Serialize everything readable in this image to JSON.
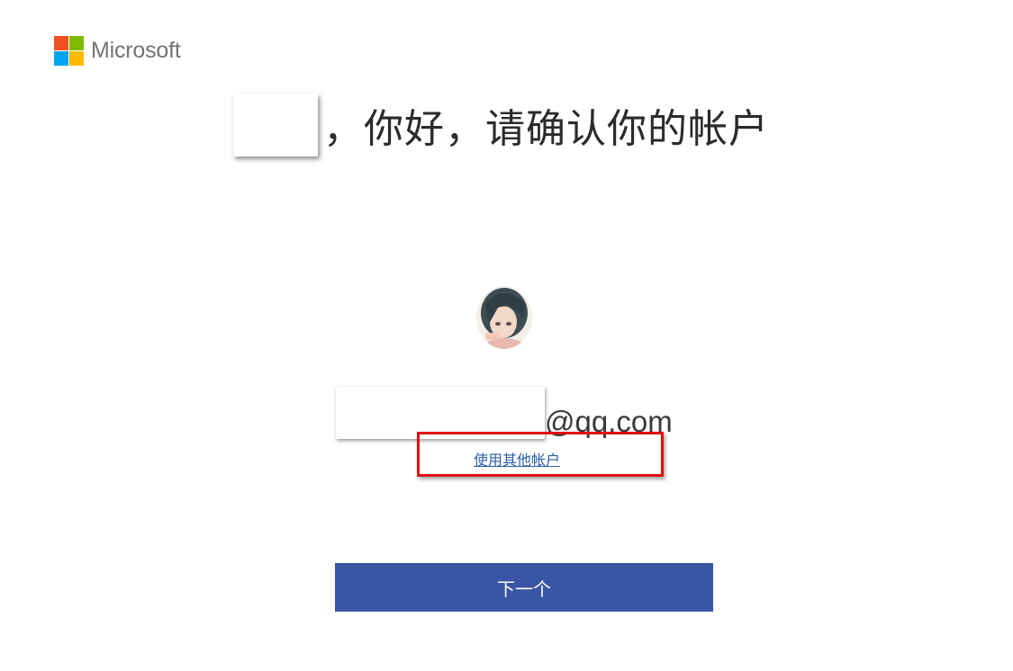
{
  "brand": {
    "name": "Microsoft",
    "logo_colors": [
      "#f25022",
      "#7fba00",
      "#00a4ef",
      "#ffb900"
    ]
  },
  "heading": {
    "greeting": "，你好，请确认你的帐户"
  },
  "account": {
    "avatar_icon": "user-avatar-icon",
    "email_domain": "@qq.com"
  },
  "links": {
    "use_other_account": "使用其他帐户"
  },
  "actions": {
    "next_label": "下一个",
    "accent_color": "#3a55a4"
  },
  "annotation": {
    "highlight_color": "#e01010"
  }
}
